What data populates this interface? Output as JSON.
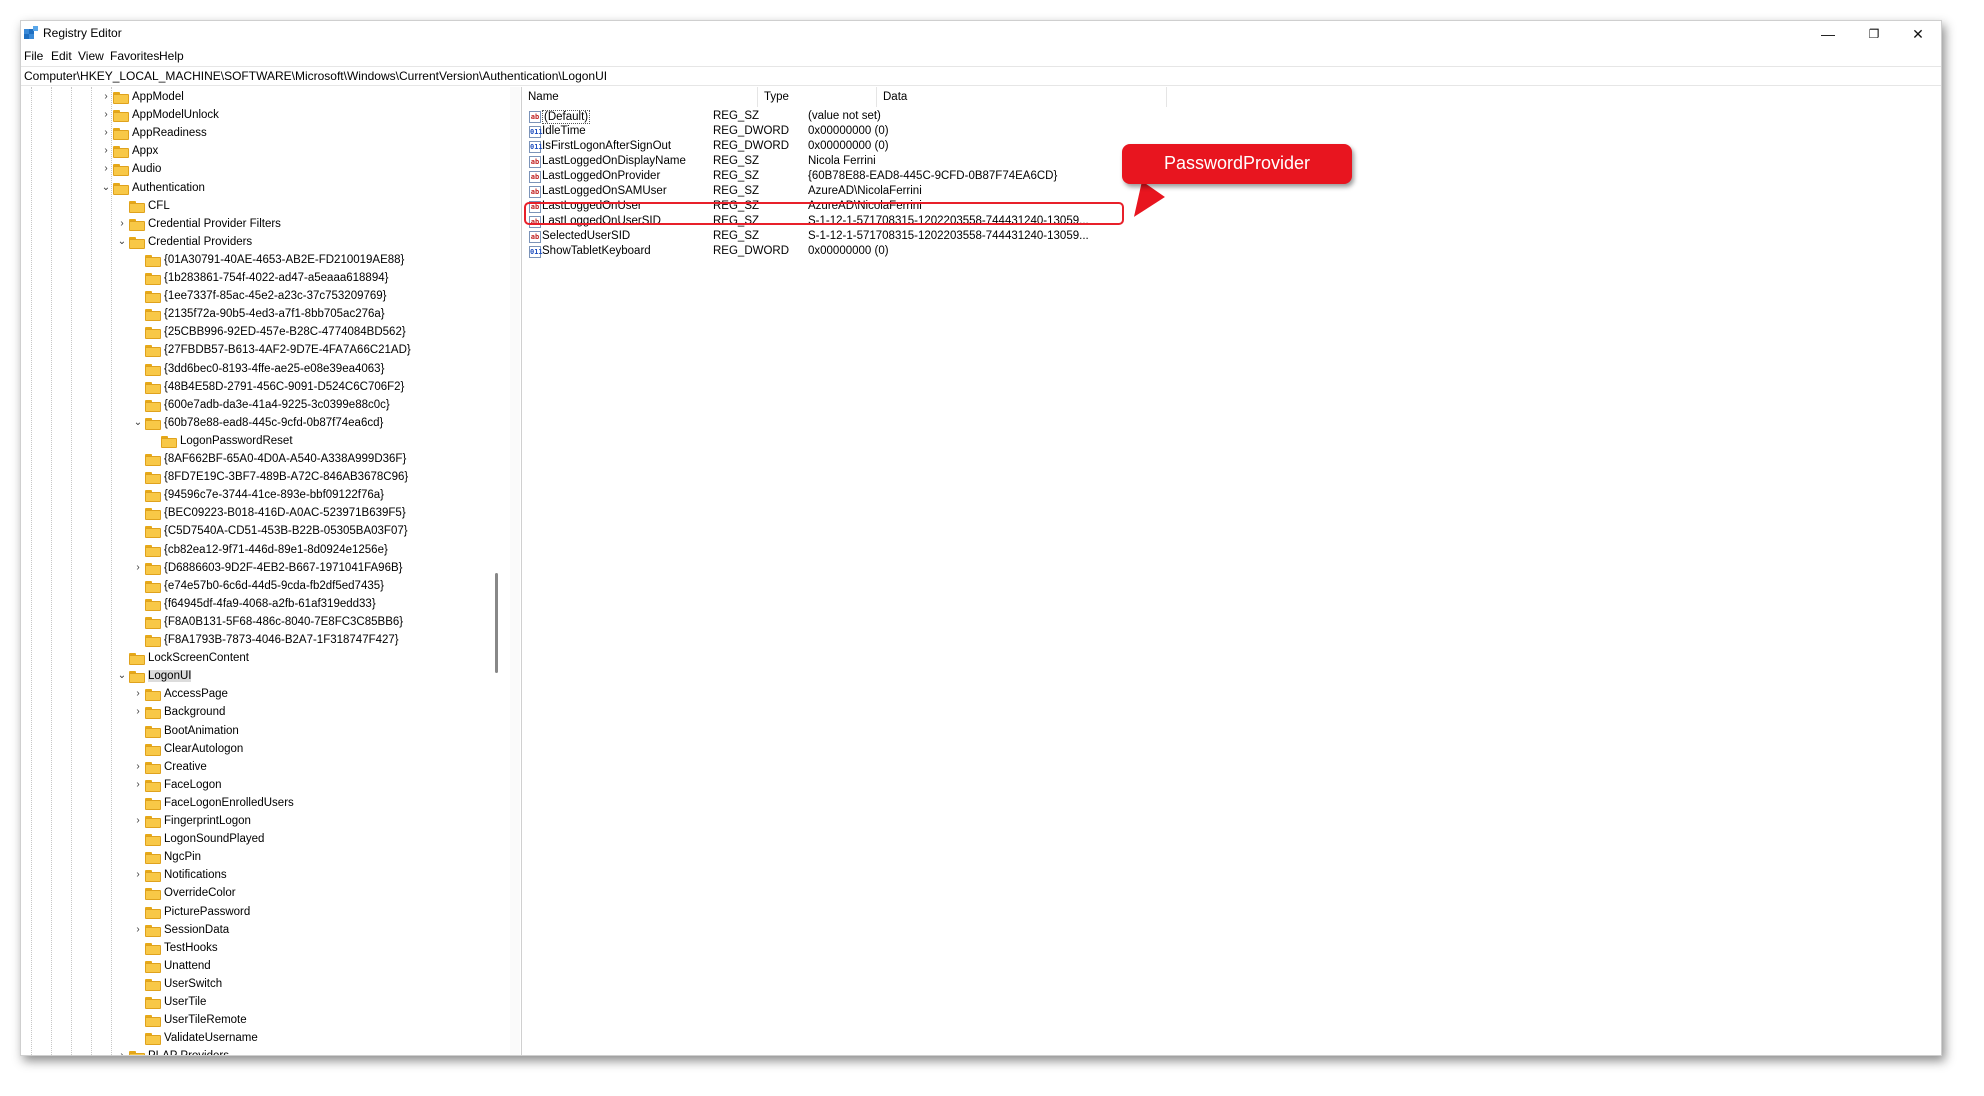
{
  "window": {
    "title": "Registry Editor",
    "minimize_glyph": "—",
    "restore_glyph": "❐",
    "close_glyph": "✕",
    "app_icon": "registry-icon"
  },
  "menu": [
    "File",
    "Edit",
    "View",
    "Favorites",
    "Help"
  ],
  "address": "Computer\\HKEY_LOCAL_MACHINE\\SOFTWARE\\Microsoft\\Windows\\CurrentVersion\\Authentication\\LogonUI",
  "tree": [
    {
      "label": "AppModel",
      "level": 0,
      "chevron": "›"
    },
    {
      "label": "AppModelUnlock",
      "level": 0,
      "chevron": "›"
    },
    {
      "label": "AppReadiness",
      "level": 0,
      "chevron": "›"
    },
    {
      "label": "Appx",
      "level": 0,
      "chevron": "›"
    },
    {
      "label": "Audio",
      "level": 0,
      "chevron": "›"
    },
    {
      "label": "Authentication",
      "level": 0,
      "chevron": "⌄"
    },
    {
      "label": "CFL",
      "level": 1,
      "chevron": ""
    },
    {
      "label": "Credential Provider Filters",
      "level": 1,
      "chevron": "›"
    },
    {
      "label": "Credential Providers",
      "level": 1,
      "chevron": "⌄"
    },
    {
      "label": "{01A30791-40AE-4653-AB2E-FD210019AE88}",
      "level": 2,
      "chevron": ""
    },
    {
      "label": "{1b283861-754f-4022-ad47-a5eaaa618894}",
      "level": 2,
      "chevron": ""
    },
    {
      "label": "{1ee7337f-85ac-45e2-a23c-37c753209769}",
      "level": 2,
      "chevron": ""
    },
    {
      "label": "{2135f72a-90b5-4ed3-a7f1-8bb705ac276a}",
      "level": 2,
      "chevron": ""
    },
    {
      "label": "{25CBB996-92ED-457e-B28C-4774084BD562}",
      "level": 2,
      "chevron": ""
    },
    {
      "label": "{27FBDB57-B613-4AF2-9D7E-4FA7A66C21AD}",
      "level": 2,
      "chevron": ""
    },
    {
      "label": "{3dd6bec0-8193-4ffe-ae25-e08e39ea4063}",
      "level": 2,
      "chevron": ""
    },
    {
      "label": "{48B4E58D-2791-456C-9091-D524C6C706F2}",
      "level": 2,
      "chevron": ""
    },
    {
      "label": "{600e7adb-da3e-41a4-9225-3c0399e88c0c}",
      "level": 2,
      "chevron": ""
    },
    {
      "label": "{60b78e88-ead8-445c-9cfd-0b87f74ea6cd}",
      "level": 2,
      "chevron": "⌄"
    },
    {
      "label": "LogonPasswordReset",
      "level": 3,
      "chevron": ""
    },
    {
      "label": "{8AF662BF-65A0-4D0A-A540-A338A999D36F}",
      "level": 2,
      "chevron": ""
    },
    {
      "label": "{8FD7E19C-3BF7-489B-A72C-846AB3678C96}",
      "level": 2,
      "chevron": ""
    },
    {
      "label": "{94596c7e-3744-41ce-893e-bbf09122f76a}",
      "level": 2,
      "chevron": ""
    },
    {
      "label": "{BEC09223-B018-416D-A0AC-523971B639F5}",
      "level": 2,
      "chevron": ""
    },
    {
      "label": "{C5D7540A-CD51-453B-B22B-05305BA03F07}",
      "level": 2,
      "chevron": ""
    },
    {
      "label": "{cb82ea12-9f71-446d-89e1-8d0924e1256e}",
      "level": 2,
      "chevron": ""
    },
    {
      "label": "{D6886603-9D2F-4EB2-B667-1971041FA96B}",
      "level": 2,
      "chevron": "›"
    },
    {
      "label": "{e74e57b0-6c6d-44d5-9cda-fb2df5ed7435}",
      "level": 2,
      "chevron": ""
    },
    {
      "label": "{f64945df-4fa9-4068-a2fb-61af319edd33}",
      "level": 2,
      "chevron": ""
    },
    {
      "label": "{F8A0B131-5F68-486c-8040-7E8FC3C85BB6}",
      "level": 2,
      "chevron": ""
    },
    {
      "label": "{F8A1793B-7873-4046-B2A7-1F318747F427}",
      "level": 2,
      "chevron": ""
    },
    {
      "label": "LockScreenContent",
      "level": 1,
      "chevron": ""
    },
    {
      "label": "LogonUI",
      "level": 1,
      "chevron": "⌄",
      "selected": true
    },
    {
      "label": "AccessPage",
      "level": 2,
      "chevron": "›"
    },
    {
      "label": "Background",
      "level": 2,
      "chevron": "›"
    },
    {
      "label": "BootAnimation",
      "level": 2,
      "chevron": ""
    },
    {
      "label": "ClearAutologon",
      "level": 2,
      "chevron": ""
    },
    {
      "label": "Creative",
      "level": 2,
      "chevron": "›"
    },
    {
      "label": "FaceLogon",
      "level": 2,
      "chevron": "›"
    },
    {
      "label": "FaceLogonEnrolledUsers",
      "level": 2,
      "chevron": ""
    },
    {
      "label": "FingerprintLogon",
      "level": 2,
      "chevron": "›"
    },
    {
      "label": "LogonSoundPlayed",
      "level": 2,
      "chevron": ""
    },
    {
      "label": "NgcPin",
      "level": 2,
      "chevron": ""
    },
    {
      "label": "Notifications",
      "level": 2,
      "chevron": "›"
    },
    {
      "label": "OverrideColor",
      "level": 2,
      "chevron": ""
    },
    {
      "label": "PicturePassword",
      "level": 2,
      "chevron": ""
    },
    {
      "label": "SessionData",
      "level": 2,
      "chevron": "›"
    },
    {
      "label": "TestHooks",
      "level": 2,
      "chevron": ""
    },
    {
      "label": "Unattend",
      "level": 2,
      "chevron": ""
    },
    {
      "label": "UserSwitch",
      "level": 2,
      "chevron": ""
    },
    {
      "label": "UserTile",
      "level": 2,
      "chevron": ""
    },
    {
      "label": "UserTileRemote",
      "level": 2,
      "chevron": ""
    },
    {
      "label": "ValidateUsername",
      "level": 2,
      "chevron": ""
    },
    {
      "label": "PLAP Providers",
      "level": 1,
      "chevron": "›"
    }
  ],
  "columns": {
    "name": "Name",
    "type": "Type",
    "data": "Data"
  },
  "values": [
    {
      "name": "(Default)",
      "type": "REG_SZ",
      "data": "(value not set)",
      "icon": "ab"
    },
    {
      "name": "IdleTime",
      "type": "REG_DWORD",
      "data": "0x00000000 (0)",
      "icon": "011"
    },
    {
      "name": "IsFirstLogonAfterSignOut",
      "type": "REG_DWORD",
      "data": "0x00000000 (0)",
      "icon": "011"
    },
    {
      "name": "LastLoggedOnDisplayName",
      "type": "REG_SZ",
      "data": "Nicola Ferrini",
      "icon": "ab"
    },
    {
      "name": "LastLoggedOnProvider",
      "type": "REG_SZ",
      "data": "{60B78E88-EAD8-445C-9CFD-0B87F74EA6CD}",
      "icon": "ab"
    },
    {
      "name": "LastLoggedOnSAMUser",
      "type": "REG_SZ",
      "data": "AzureAD\\NicolaFerrini",
      "icon": "ab"
    },
    {
      "name": "LastLoggedOnUser",
      "type": "REG_SZ",
      "data": "AzureAD\\NicolaFerrini",
      "icon": "ab"
    },
    {
      "name": "LastLoggedOnUserSID",
      "type": "REG_SZ",
      "data": "S-1-12-1-571708315-1202203558-744431240-13059...",
      "icon": "ab"
    },
    {
      "name": "SelectedUserSID",
      "type": "REG_SZ",
      "data": "S-1-12-1-571708315-1202203558-744431240-13059...",
      "icon": "ab"
    },
    {
      "name": "ShowTabletKeyboard",
      "type": "REG_DWORD",
      "data": "0x00000000 (0)",
      "icon": "011"
    }
  ],
  "callout": {
    "label": "PasswordProvider",
    "color": "#e8151f"
  }
}
